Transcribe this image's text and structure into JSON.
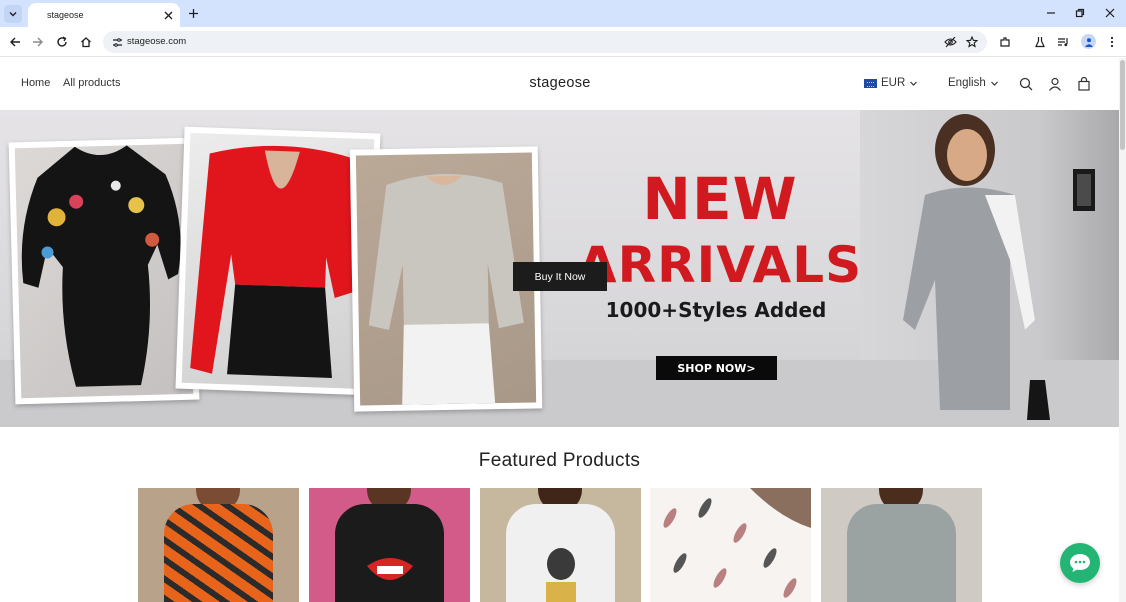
{
  "browser": {
    "tab_title": "stageose",
    "url": "stageose.com"
  },
  "header": {
    "nav": [
      {
        "label": "Home"
      },
      {
        "label": "All products"
      }
    ],
    "brand": "stageose",
    "currency": "EUR",
    "language": "English"
  },
  "hero": {
    "title_line1": "NEW",
    "title_line2": "ARRIVALS",
    "subtitle": "1000+Styles Added",
    "shop_now_label": "SHOP NOW>",
    "buy_now_label": "Buy It Now"
  },
  "featured": {
    "title": "Featured Products",
    "products": [
      {
        "color": "#e8641b",
        "accent": "#2b2b2b"
      },
      {
        "color": "#1b1b1b",
        "accent": "#d52525"
      },
      {
        "color": "#f0f0f0",
        "accent": "#3a3a3a"
      },
      {
        "color": "#f6f3f1",
        "accent": "#b98080"
      },
      {
        "color": "#9aa3a2",
        "accent": "#8a9392"
      }
    ]
  },
  "colors": {
    "accent_red": "#d11a1f",
    "chat_green": "#22b573",
    "chrome_blue": "#d3e3fd"
  },
  "icons": {
    "search": "search-icon",
    "account": "account-icon",
    "cart": "cart-icon",
    "chat": "chat-icon"
  }
}
